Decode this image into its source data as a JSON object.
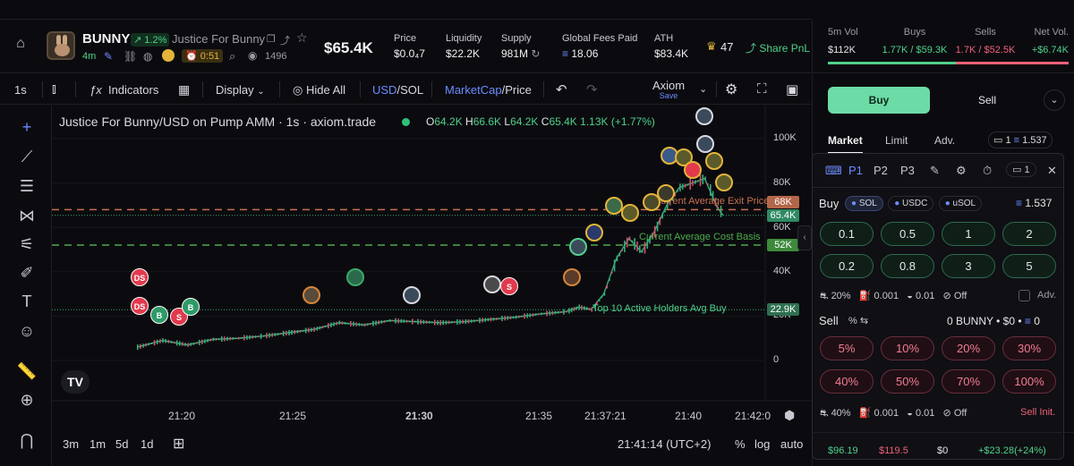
{
  "header": {
    "token_symbol": "BUNNY",
    "change_pct": "1.2%",
    "token_name": "Justice For Bunny",
    "age": "4m",
    "timer": "0:51",
    "watchers": "1496",
    "market_cap": "$65.4K",
    "stats": [
      {
        "label": "Price",
        "value": "$0.0₄7"
      },
      {
        "label": "Liquidity",
        "value": "$22.2K"
      },
      {
        "label": "Supply",
        "value": "981M"
      },
      {
        "label": "Global Fees Paid",
        "value": "18.06"
      },
      {
        "label": "ATH",
        "value": "$83.4K"
      }
    ],
    "crown_count": "47",
    "share_label": "Share PnL"
  },
  "right_stats": {
    "vol_label": "5m Vol",
    "vol_value": "$112K",
    "buys_label": "Buys",
    "buys_value": "1.77K / $59.3K",
    "sells_label": "Sells",
    "sells_value": "1.7K / $52.5K",
    "net_label": "Net Vol.",
    "net_value": "+$6.74K",
    "buy_ratio": 0.53
  },
  "toolbar": {
    "interval": "1s",
    "indicators": "Indicators",
    "display": "Display",
    "hide_all": "Hide All",
    "pair_usd": "USD",
    "pair_sol": "SOL",
    "mode_mc": "MarketCap",
    "mode_price": "Price",
    "axiom": "Axiom",
    "save": "Save"
  },
  "chart": {
    "title": "Justice For Bunny/USD on Pump AMM · 1s · axiom.trade",
    "o": "64.2K",
    "h": "66.6K",
    "l": "64.2K",
    "c": "65.4K",
    "change": "1.13K (+1.77%)",
    "exit_label": "Current Average Exit Price",
    "cost_label": "Current Average Cost Basis",
    "holders_label": "Top 10 Active Holders Avg Buy",
    "exit_value": "68K",
    "price_value": "65.4K",
    "cost_value": "52K",
    "holders_value": "22.9K",
    "time_readout": "21:41:14 (UTC+2)",
    "ranges": [
      "3m",
      "1m",
      "5d",
      "1d"
    ],
    "pct_label": "%",
    "log_label": "log",
    "auto_label": "auto"
  },
  "chart_data": {
    "type": "line",
    "y_ticks": [
      "100K",
      "80K",
      "60K",
      "40K",
      "20K",
      "0"
    ],
    "x_ticks": [
      "21:20",
      "21:25",
      "21:30",
      "21:35",
      "21:37:21",
      "21:40",
      "21:42:0"
    ],
    "ylim": [
      0,
      110000
    ],
    "x": [
      "21:18:00",
      "21:19:00",
      "21:20:00",
      "21:21:00",
      "21:22:00",
      "21:23:00",
      "21:24:00",
      "21:25:00",
      "21:26:00",
      "21:27:00",
      "21:28:00",
      "21:29:00",
      "21:30:00",
      "21:31:00",
      "21:32:00",
      "21:33:00",
      "21:34:00",
      "21:35:00",
      "21:35:30",
      "21:36:00",
      "21:36:30",
      "21:37:00",
      "21:37:30",
      "21:38:00",
      "21:38:30",
      "21:39:00",
      "21:39:30",
      "21:40:00",
      "21:40:30",
      "21:41:00",
      "21:41:14"
    ],
    "series": [
      {
        "values": [
          6000,
          9000,
          7000,
          9500,
          10000,
          11000,
          12500,
          14000,
          17000,
          16000,
          18000,
          17500,
          17000,
          17500,
          18500,
          19500,
          21000,
          22000,
          24000,
          23000,
          30000,
          46000,
          55000,
          49000,
          58000,
          70000,
          78000,
          80000,
          82000,
          69000,
          65400
        ]
      }
    ]
  },
  "right_panel": {
    "buy": "Buy",
    "sell": "Sell",
    "market": "Market",
    "limit": "Limit",
    "adv": "Adv.",
    "wallet_count": "1",
    "balance": "1.537"
  },
  "float_panel": {
    "presets": [
      "P1",
      "P2",
      "P3"
    ],
    "wallets": "1",
    "buy_label": "Buy",
    "currencies": [
      "SOL",
      "USDC",
      "uSOL"
    ],
    "balance": "1.537",
    "buy_amounts": [
      "0.1",
      "0.5",
      "1",
      "2",
      "0.2",
      "0.8",
      "3",
      "5"
    ],
    "buy_settings": {
      "slippage": "20%",
      "priority": "0.001",
      "bribe": "0.01",
      "mev": "Off",
      "adv": "Adv."
    },
    "sell_label": "Sell",
    "sell_holding": "0 BUNNY • $0 •",
    "sell_sol": "0",
    "sell_amounts": [
      "5%",
      "10%",
      "20%",
      "30%",
      "40%",
      "50%",
      "70%",
      "100%"
    ],
    "sell_settings": {
      "slippage": "40%",
      "priority": "0.001",
      "bribe": "0.01",
      "mev": "Off",
      "init": "Sell Init."
    }
  },
  "footer": {
    "bought": "$96.19",
    "sold": "$119.5",
    "holding": "$0",
    "pnl": "+$23.28(+24%)"
  }
}
